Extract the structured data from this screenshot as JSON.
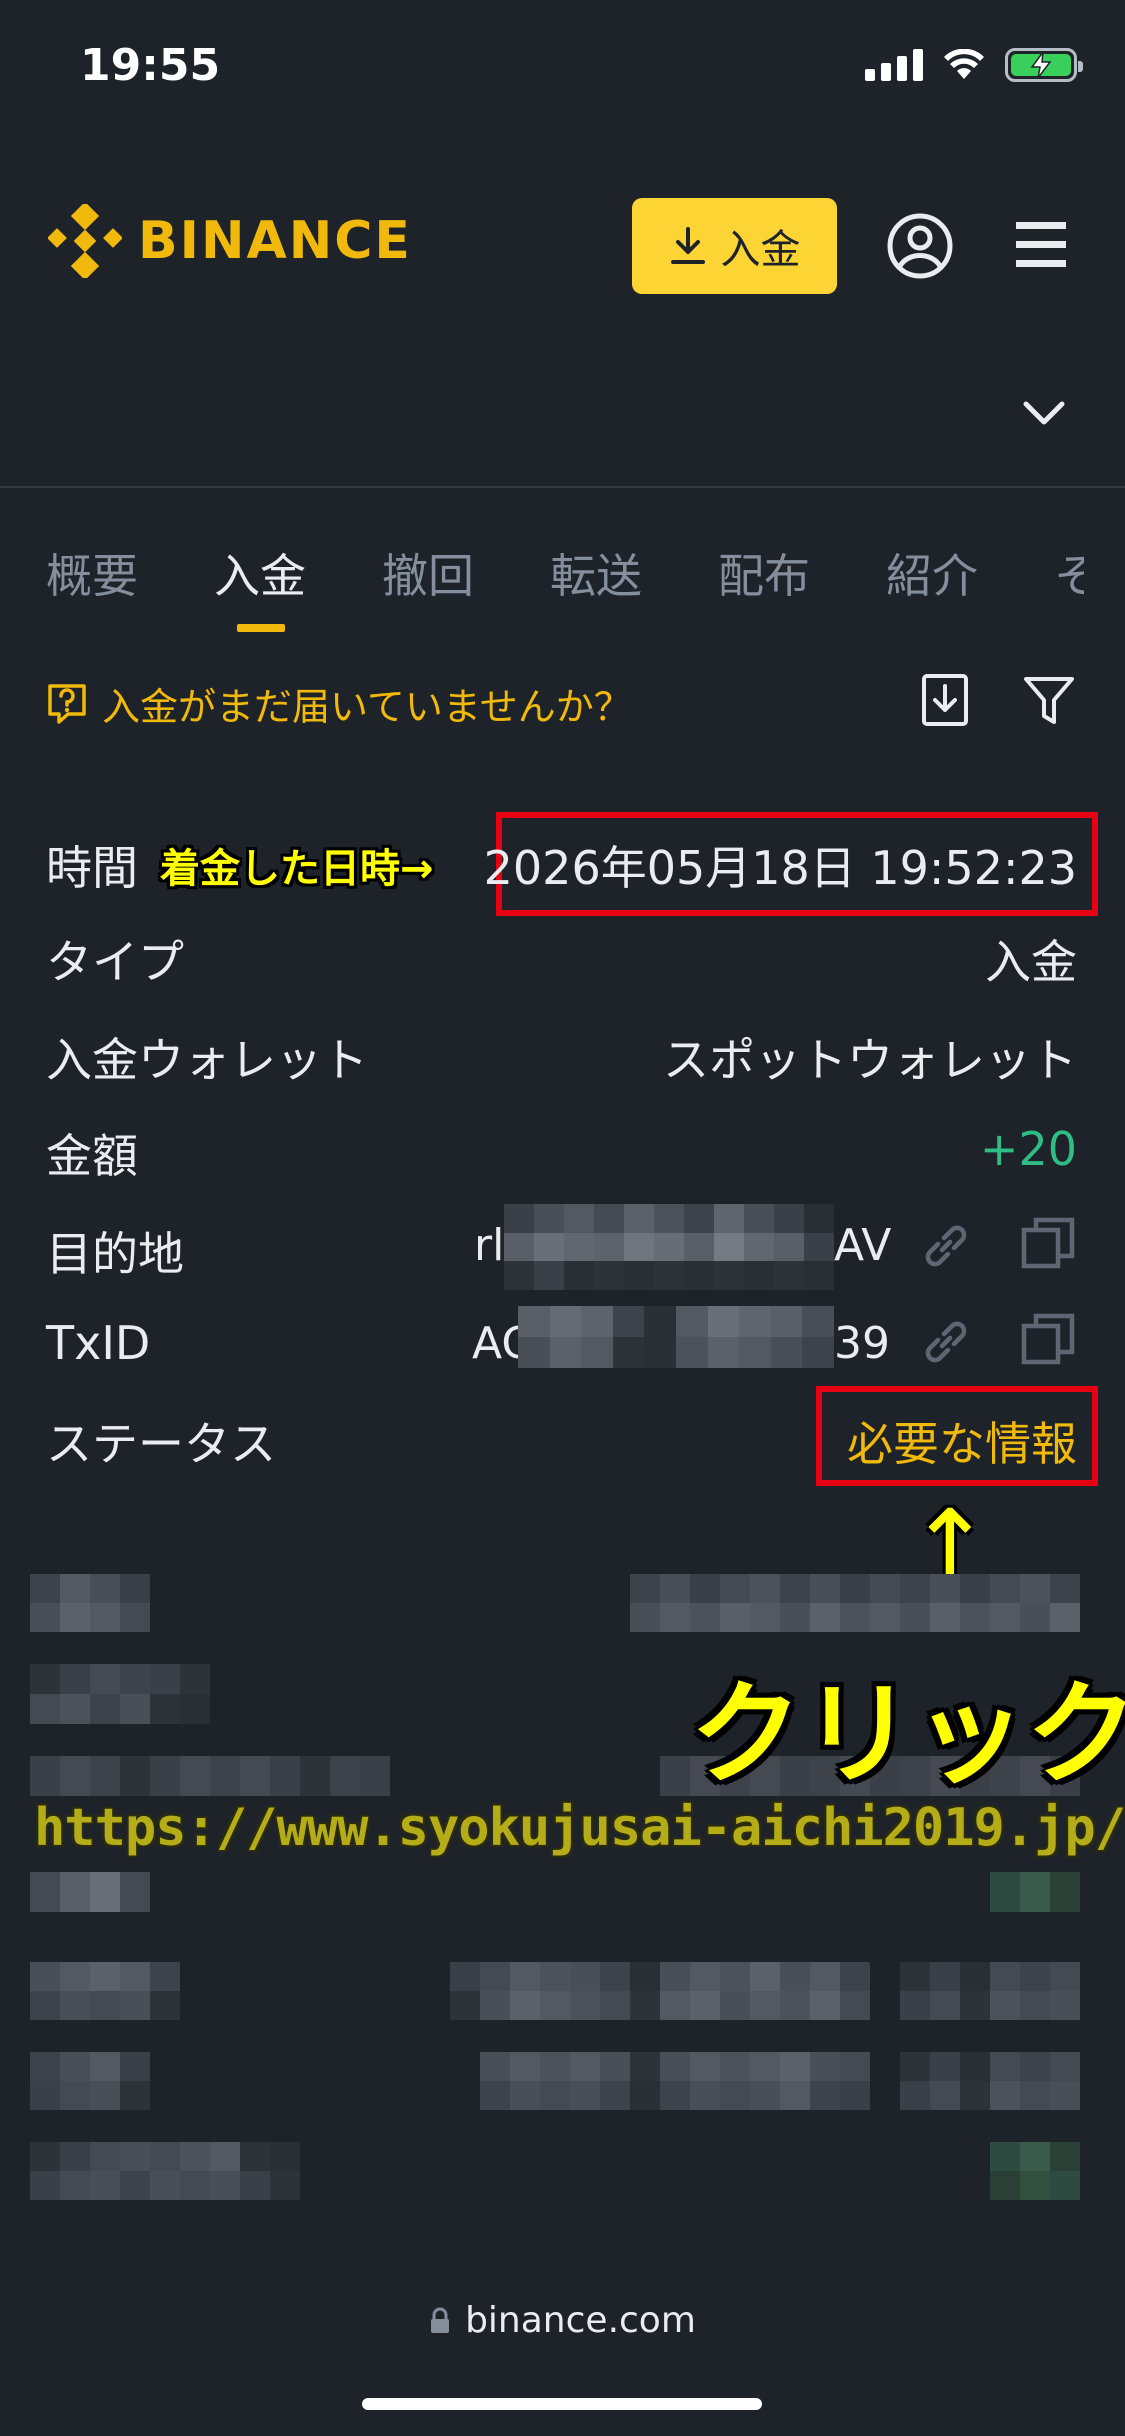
{
  "status_bar": {
    "time": "19:55"
  },
  "header": {
    "logo_text": "BINANCE",
    "deposit_label": "入金"
  },
  "tabs": [
    {
      "label": "概要",
      "active": false
    },
    {
      "label": "入金",
      "active": true
    },
    {
      "label": "撤回",
      "active": false
    },
    {
      "label": "転送",
      "active": false
    },
    {
      "label": "配布",
      "active": false
    },
    {
      "label": "紹介",
      "active": false
    },
    {
      "label": "そ",
      "active": false
    }
  ],
  "notice": {
    "text": "入金がまだ届いていませんか？"
  },
  "details": {
    "time_label": "時間",
    "time_value": "2026年05月18日 19:52:23",
    "type_label": "タイプ",
    "type_value": "入金",
    "wallet_label": "入金ウォレット",
    "wallet_value": "スポットウォレット",
    "amount_label": "金額",
    "amount_value": "+20",
    "destination_label": "目的地",
    "destination_prefix": "rl",
    "destination_suffix": "AV",
    "txid_label": "TxID",
    "txid_prefix": "AC",
    "txid_suffix": "39",
    "status_label": "ステータス",
    "status_value": "必要な情報"
  },
  "annotations": {
    "arrival_time": "着金した日時→",
    "up_arrow": "↑",
    "click": "クリック",
    "watermark": "https://www.syokujusai-aichi2019.jp/"
  },
  "browser": {
    "url": "binance.com"
  },
  "colors": {
    "background": "#1e2329",
    "accent": "#f0b90b",
    "button": "#fcd535",
    "positive": "#2ebd85",
    "highlight_box": "#e60012"
  }
}
